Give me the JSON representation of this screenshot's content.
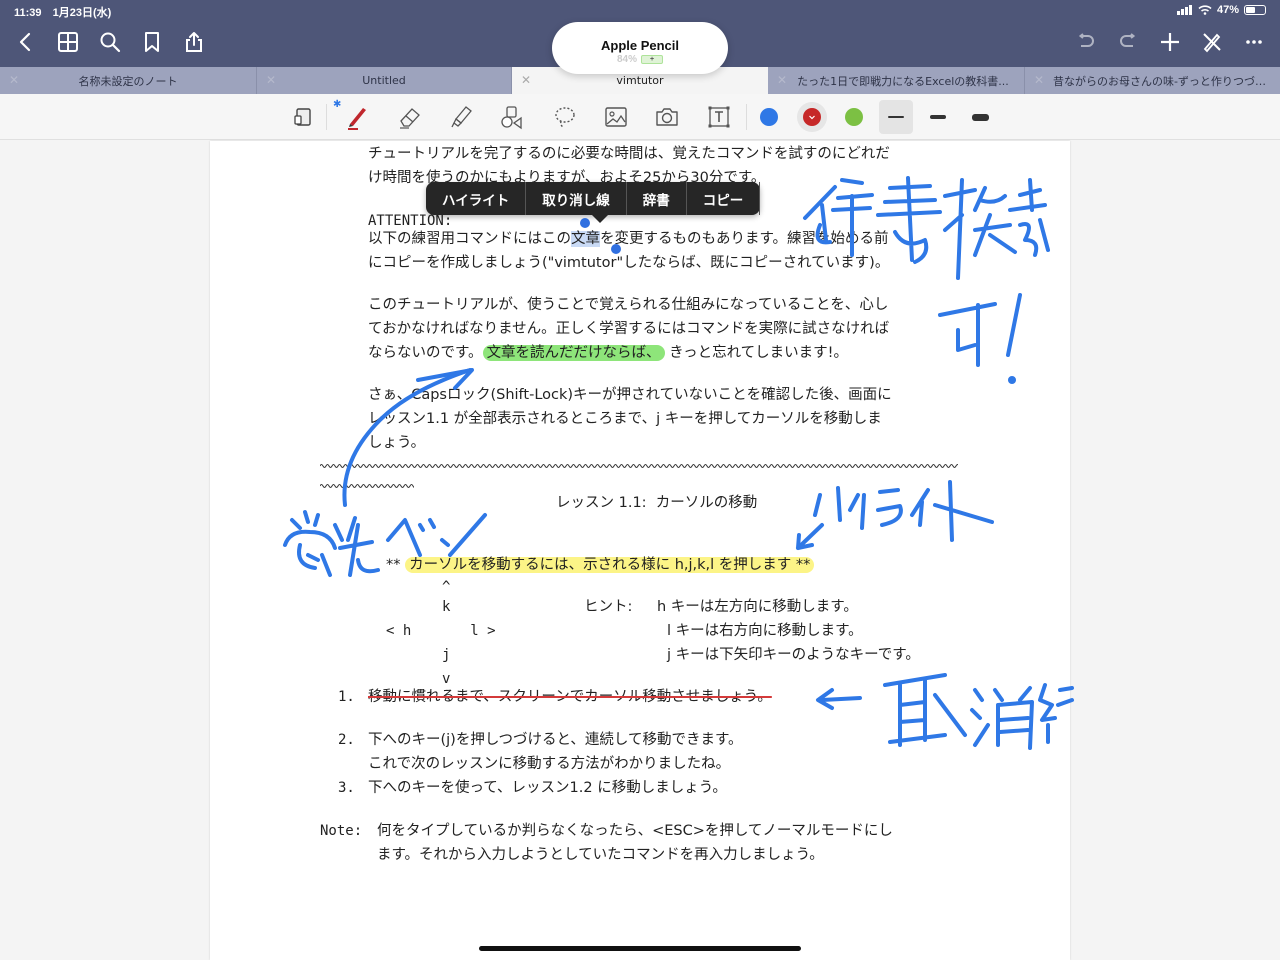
{
  "status": {
    "time": "11:39",
    "date": "1月23日(水)",
    "battery": "47%"
  },
  "nav": {
    "left_icons": [
      "back-icon",
      "grid-icon",
      "search-icon",
      "bookmark-icon",
      "share-icon"
    ],
    "right_icons": [
      "undo-icon",
      "redo-icon",
      "add-icon",
      "pen-off-icon",
      "more-icon"
    ]
  },
  "pencil_popup": {
    "title": "Apple Pencil",
    "battery": "84%",
    "charging_glyph": "+"
  },
  "tabs": [
    {
      "label": "名称未設定のノート",
      "active": false
    },
    {
      "label": "Untitled",
      "active": false
    },
    {
      "label": "vimtutor",
      "active": true
    },
    {
      "label": "たった1日で即戦力になるExcelの教科書...",
      "active": false
    },
    {
      "label": "昔ながらのお母さんの味-ずっと作りつづ…",
      "active": false
    }
  ],
  "toolbar": {
    "tools": [
      "page-layout-icon",
      "pen-icon",
      "eraser-icon",
      "highlighter-icon",
      "shapes-icon",
      "lasso-icon",
      "image-icon",
      "camera-icon",
      "textbox-icon"
    ],
    "bluetooth_glyph": "✱",
    "colors": [
      "#2f78e6",
      "#c62828",
      "#7cc043"
    ],
    "selected_color": "#c62828",
    "thicknesses": [
      "thin",
      "medium",
      "thick"
    ],
    "selected_thickness": "thin"
  },
  "context_menu": {
    "items": [
      "ハイライト",
      "取り消し線",
      "辞書",
      "コピー"
    ]
  },
  "document": {
    "intro_line1": "チュートリアルを完了するのに必要な時間は、覚えたコマンドを試すのにどれだ",
    "intro_line2": "け時間を使うのかにもよりますが、およそ25から30分です。",
    "attention": "ATTENTION:",
    "att_line1_pre": "以下の練習用コマンドにはこの",
    "att_line1_sel": "文章",
    "att_line1_post": "を変更するものもあります。練習を始める前",
    "att_line2": "にコピーを作成しましょう(\"vimtutor\"したならば、既にコピーされています)。",
    "p2_line1": "このチュートリアルが、使うことで覚えられる仕組みになっていることを、心し",
    "p2_line2": "ておかなければなりません。正しく学習するにはコマンドを実際に試さなければ",
    "p2_line3_pre": "ならないのです。",
    "p2_line3_hl": "文章を読んだだけならば、",
    "p2_line3_post": "きっと忘れてしまいます!。",
    "p3_line1": "さぁ、Capsロック(Shift-Lock)キーが押されていないことを確認した後、画面に",
    "p3_line2": "レッスン1.1 が全部表示されるところまで、j キーを押してカーソルを移動しま",
    "p3_line3": "しょう。",
    "lesson_title": "レッスン 1.1:  カーソルの移動",
    "hl_pre": "**",
    "hl_text": "カーソルを移動するには、示される様に h,j,k,l を押します **",
    "diagram": {
      "up": "^",
      "k": "k",
      "hl": "< h       l >",
      "j": "j",
      "v": "v"
    },
    "hint_label": "ヒント:",
    "hint_h": "h キーは左方向に移動します。",
    "hint_l": "l キーは右方向に移動します。",
    "hint_j": "j キーは下矢印キーのようなキーです。",
    "list": [
      {
        "num": "1.",
        "text": "移動に慣れるまで、スクリーンでカーソル移動させましょう。",
        "strike": true
      },
      {
        "num": "2.",
        "text": "下へのキー(j)を押しつづけると、連続して移動できます。",
        "strike": false
      },
      {
        "num": "",
        "text": "これで次のレッスンに移動する方法がわかりましたね。",
        "strike": false
      },
      {
        "num": "3.",
        "text": "下へのキーを使って、レッスン1.2 に移動しましょう。",
        "strike": false
      }
    ],
    "note_label": "Note:",
    "note_line1": "何をタイプしているか判らなくなったら、<ESC>を押してノーマルモードにし",
    "note_line2": "ます。それから入力しようとしていたコマンドを再入力しましょう。"
  },
  "annotations": {
    "ink_color": "#2f78e6",
    "dict_search": "辞書検索可!",
    "highlighter": "蛍光ペン",
    "highlight": "ハイライト",
    "strikethrough": "取消線"
  }
}
